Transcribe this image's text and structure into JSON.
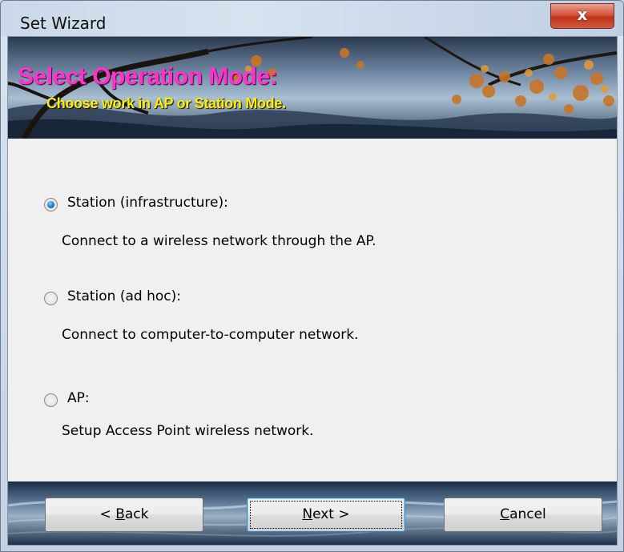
{
  "window": {
    "title": "Set Wizard",
    "close_glyph": "x"
  },
  "banner": {
    "title": "Select Operation Mode:",
    "subtitle": "Choose work in AP or Station Mode."
  },
  "options": [
    {
      "label": "Station (infrastructure):",
      "description": "Connect to a wireless network through the AP.",
      "checked": true
    },
    {
      "label": "Station (ad hoc):",
      "description": "Connect to computer-to-computer network.",
      "checked": false
    },
    {
      "label": "AP:",
      "description": "Setup Access Point wireless network.",
      "checked": false
    }
  ],
  "buttons": {
    "back": {
      "prefix": "< ",
      "mnemonic": "B",
      "rest": "ack"
    },
    "next": {
      "mnemonic": "N",
      "rest": "ext >"
    },
    "cancel": {
      "mnemonic": "C",
      "rest": "ancel"
    }
  },
  "colors": {
    "banner_title": "#ff33cc",
    "banner_subtitle": "#ffee00",
    "close_button": "#c8412a",
    "radio_selected": "#1b75c4"
  }
}
